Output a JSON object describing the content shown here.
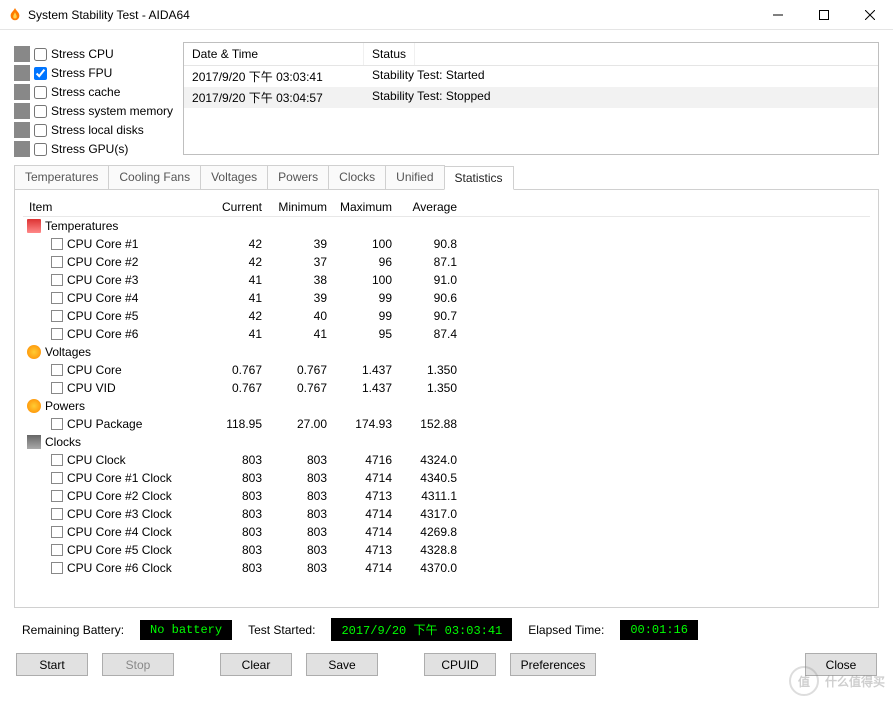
{
  "window": {
    "title": "System Stability Test - AIDA64"
  },
  "stress": {
    "items": [
      {
        "label": "Stress CPU",
        "iconClass": "di-cpu",
        "checked": false
      },
      {
        "label": "Stress FPU",
        "iconClass": "di-fpu",
        "checked": true
      },
      {
        "label": "Stress cache",
        "iconClass": "di-cache",
        "checked": false
      },
      {
        "label": "Stress system memory",
        "iconClass": "di-mem",
        "checked": false
      },
      {
        "label": "Stress local disks",
        "iconClass": "di-disk",
        "checked": false
      },
      {
        "label": "Stress GPU(s)",
        "iconClass": "di-gpu",
        "checked": false
      }
    ]
  },
  "log": {
    "headers": {
      "dt": "Date & Time",
      "status": "Status"
    },
    "rows": [
      {
        "dt": "2017/9/20 下午 03:03:41",
        "status": "Stability Test: Started",
        "sel": false
      },
      {
        "dt": "2017/9/20 下午 03:04:57",
        "status": "Stability Test: Stopped",
        "sel": true
      }
    ]
  },
  "tabs": {
    "list": [
      "Temperatures",
      "Cooling Fans",
      "Voltages",
      "Powers",
      "Clocks",
      "Unified",
      "Statistics"
    ],
    "active": 6
  },
  "stats": {
    "headers": {
      "item": "Item",
      "cur": "Current",
      "min": "Minimum",
      "max": "Maximum",
      "avg": "Average"
    },
    "groups": [
      {
        "name": "Temperatures",
        "iconClass": "ic-temp",
        "rows": [
          {
            "name": "CPU Core #1",
            "cur": "42",
            "min": "39",
            "max": "100",
            "avg": "90.8"
          },
          {
            "name": "CPU Core #2",
            "cur": "42",
            "min": "37",
            "max": "96",
            "avg": "87.1"
          },
          {
            "name": "CPU Core #3",
            "cur": "41",
            "min": "38",
            "max": "100",
            "avg": "91.0"
          },
          {
            "name": "CPU Core #4",
            "cur": "41",
            "min": "39",
            "max": "99",
            "avg": "90.6"
          },
          {
            "name": "CPU Core #5",
            "cur": "42",
            "min": "40",
            "max": "99",
            "avg": "90.7"
          },
          {
            "name": "CPU Core #6",
            "cur": "41",
            "min": "41",
            "max": "95",
            "avg": "87.4"
          }
        ]
      },
      {
        "name": "Voltages",
        "iconClass": "ic-volt",
        "rows": [
          {
            "name": "CPU Core",
            "cur": "0.767",
            "min": "0.767",
            "max": "1.437",
            "avg": "1.350"
          },
          {
            "name": "CPU VID",
            "cur": "0.767",
            "min": "0.767",
            "max": "1.437",
            "avg": "1.350"
          }
        ]
      },
      {
        "name": "Powers",
        "iconClass": "ic-pow",
        "rows": [
          {
            "name": "CPU Package",
            "cur": "118.95",
            "min": "27.00",
            "max": "174.93",
            "avg": "152.88"
          }
        ]
      },
      {
        "name": "Clocks",
        "iconClass": "ic-clk",
        "rows": [
          {
            "name": "CPU Clock",
            "cur": "803",
            "min": "803",
            "max": "4716",
            "avg": "4324.0"
          },
          {
            "name": "CPU Core #1 Clock",
            "cur": "803",
            "min": "803",
            "max": "4714",
            "avg": "4340.5"
          },
          {
            "name": "CPU Core #2 Clock",
            "cur": "803",
            "min": "803",
            "max": "4713",
            "avg": "4311.1"
          },
          {
            "name": "CPU Core #3 Clock",
            "cur": "803",
            "min": "803",
            "max": "4714",
            "avg": "4317.0"
          },
          {
            "name": "CPU Core #4 Clock",
            "cur": "803",
            "min": "803",
            "max": "4714",
            "avg": "4269.8"
          },
          {
            "name": "CPU Core #5 Clock",
            "cur": "803",
            "min": "803",
            "max": "4713",
            "avg": "4328.8"
          },
          {
            "name": "CPU Core #6 Clock",
            "cur": "803",
            "min": "803",
            "max": "4714",
            "avg": "4370.0"
          }
        ]
      }
    ]
  },
  "status": {
    "battery_label": "Remaining Battery:",
    "battery_value": "No battery",
    "started_label": "Test Started:",
    "started_value": "2017/9/20 下午 03:03:41",
    "elapsed_label": "Elapsed Time:",
    "elapsed_value": "00:01:16"
  },
  "buttons": {
    "start": "Start",
    "stop": "Stop",
    "clear": "Clear",
    "save": "Save",
    "cpuid": "CPUID",
    "prefs": "Preferences",
    "close": "Close"
  },
  "watermark": "什么值得买"
}
